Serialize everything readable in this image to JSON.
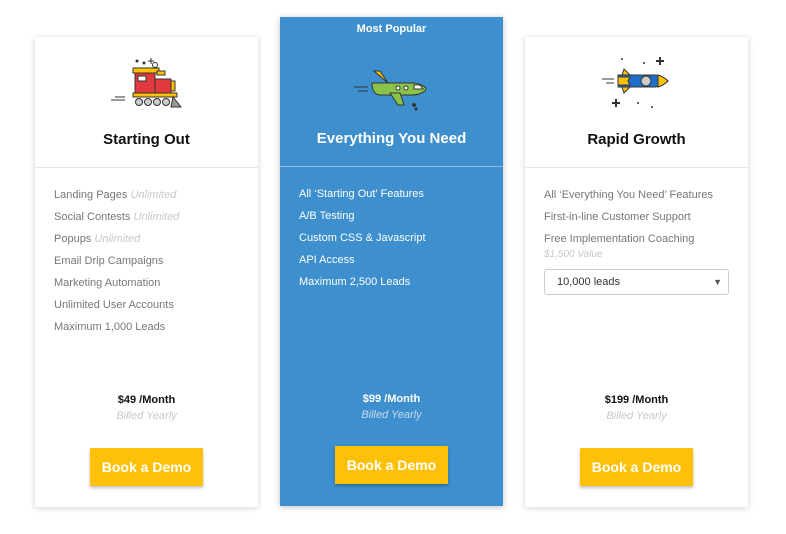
{
  "colors": {
    "featured_bg": "#3d8fcd",
    "button": "#ffc107"
  },
  "plans": [
    {
      "title": "Starting Out",
      "icon": "train-icon",
      "features": [
        {
          "text": "Landing Pages",
          "note": "Unlimited"
        },
        {
          "text": "Social Contests",
          "note": "Unlimited"
        },
        {
          "text": "Popups",
          "note": "Unlimited"
        },
        {
          "text": "Email Drip Campaigns"
        },
        {
          "text": "Marketing Automation"
        },
        {
          "text": "Unlimited User Accounts"
        },
        {
          "text": "Maximum 1,000 Leads"
        }
      ],
      "price": "$49 /Month",
      "billed": "Billed Yearly",
      "button": "Book a Demo"
    },
    {
      "badge": "Most Popular",
      "title": "Everything You Need",
      "icon": "airplane-icon",
      "features": [
        {
          "text": "All ‘Starting Out’ Features"
        },
        {
          "text": "A/B Testing"
        },
        {
          "text": "Custom CSS & Javascript"
        },
        {
          "text": "API Access"
        },
        {
          "text": "Maximum 2,500 Leads"
        }
      ],
      "price": "$99 /Month",
      "billed": "Billed Yearly",
      "button": "Book a Demo"
    },
    {
      "title": "Rapid Growth",
      "icon": "rocket-icon",
      "features": [
        {
          "text": "All ‘Everything You Need’ Features"
        },
        {
          "text": "First-in-line Customer Support"
        },
        {
          "text": "Free Implementation Coaching",
          "subnote": "$1,500 Value"
        }
      ],
      "leads_select": {
        "value": "10,000 leads"
      },
      "price": "$199 /Month",
      "billed": "Billed Yearly",
      "button": "Book a Demo"
    }
  ]
}
